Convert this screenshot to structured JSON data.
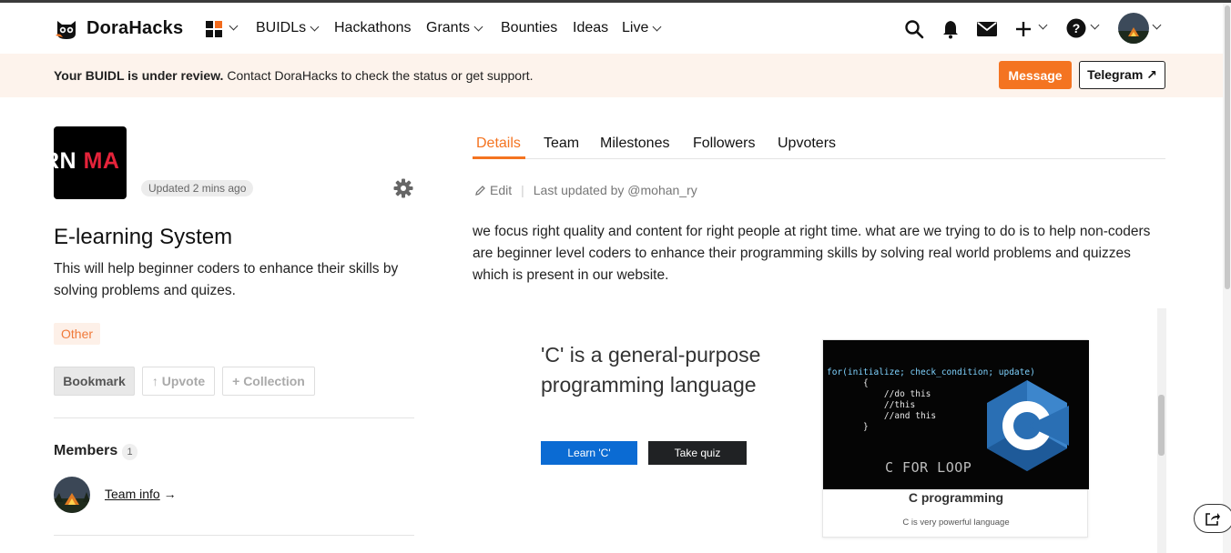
{
  "nav": {
    "logo_text": "DoraHacks",
    "items": [
      {
        "label": "BUIDLs",
        "dropdown": true
      },
      {
        "label": "Hackathons",
        "dropdown": false
      },
      {
        "label": "Grants",
        "dropdown": true
      },
      {
        "label": "Bounties",
        "dropdown": false
      },
      {
        "label": "Ideas",
        "dropdown": false
      },
      {
        "label": "Live",
        "dropdown": true
      }
    ],
    "icons": [
      "apps-grid-icon",
      "search-icon",
      "bell-icon",
      "mail-icon",
      "plus-icon",
      "help-icon",
      "avatar"
    ]
  },
  "banner": {
    "bold": "Your BUIDL is under review.",
    "text": " Contact DoraHacks to check the status or get support.",
    "message_label": "Message",
    "telegram_label": "Telegram ↗"
  },
  "project": {
    "logo_text_white": "RN ",
    "logo_text_red": "MA",
    "updated": "Updated 2 mins ago",
    "title": "E-learning System",
    "description": "This will help beginner coders to enhance their skills by solving problems and quizes.",
    "tag": "Other",
    "bookmark_label": "Bookmark",
    "upvote_label": "↑ Upvote",
    "collection_label": "+ Collection"
  },
  "members": {
    "title": "Members",
    "count": "1",
    "team_info_label": "Team info",
    "arrow": " →"
  },
  "tabs": [
    {
      "label": "Details",
      "active": true
    },
    {
      "label": "Team",
      "active": false
    },
    {
      "label": "Milestones",
      "active": false
    },
    {
      "label": "Followers",
      "active": false
    },
    {
      "label": "Upvoters",
      "active": false
    }
  ],
  "details": {
    "edit_label": "Edit",
    "last_updated": "Last updated by @mohan_ry",
    "body": "we focus right quality and content for right people at right time. what are we trying to do is to help non-coders are beginner level coders to enhance their programming skills by solving real world problems and quizzes which is present in our website."
  },
  "embed": {
    "heading": "'C' is a general-purpose programming language",
    "learn_label": "Learn 'C'",
    "quiz_label": "Take quiz",
    "card_code_line1_kw": "for(",
    "card_code_line1_rest": "initialize; check_condition; update)",
    "card_code_lines": "       {\n           //do this\n           //this\n           //and this\n       }",
    "card_caption": "C FOR LOOP",
    "card_title": "C programming",
    "card_subtitle": "C is very powerful language"
  },
  "colors": {
    "accent": "#f47421",
    "banner_bg": "#fdf3ec",
    "learn_button": "#0b6bd3",
    "quiz_button": "#202224",
    "c_logo_blue": "#2a6fb4"
  }
}
